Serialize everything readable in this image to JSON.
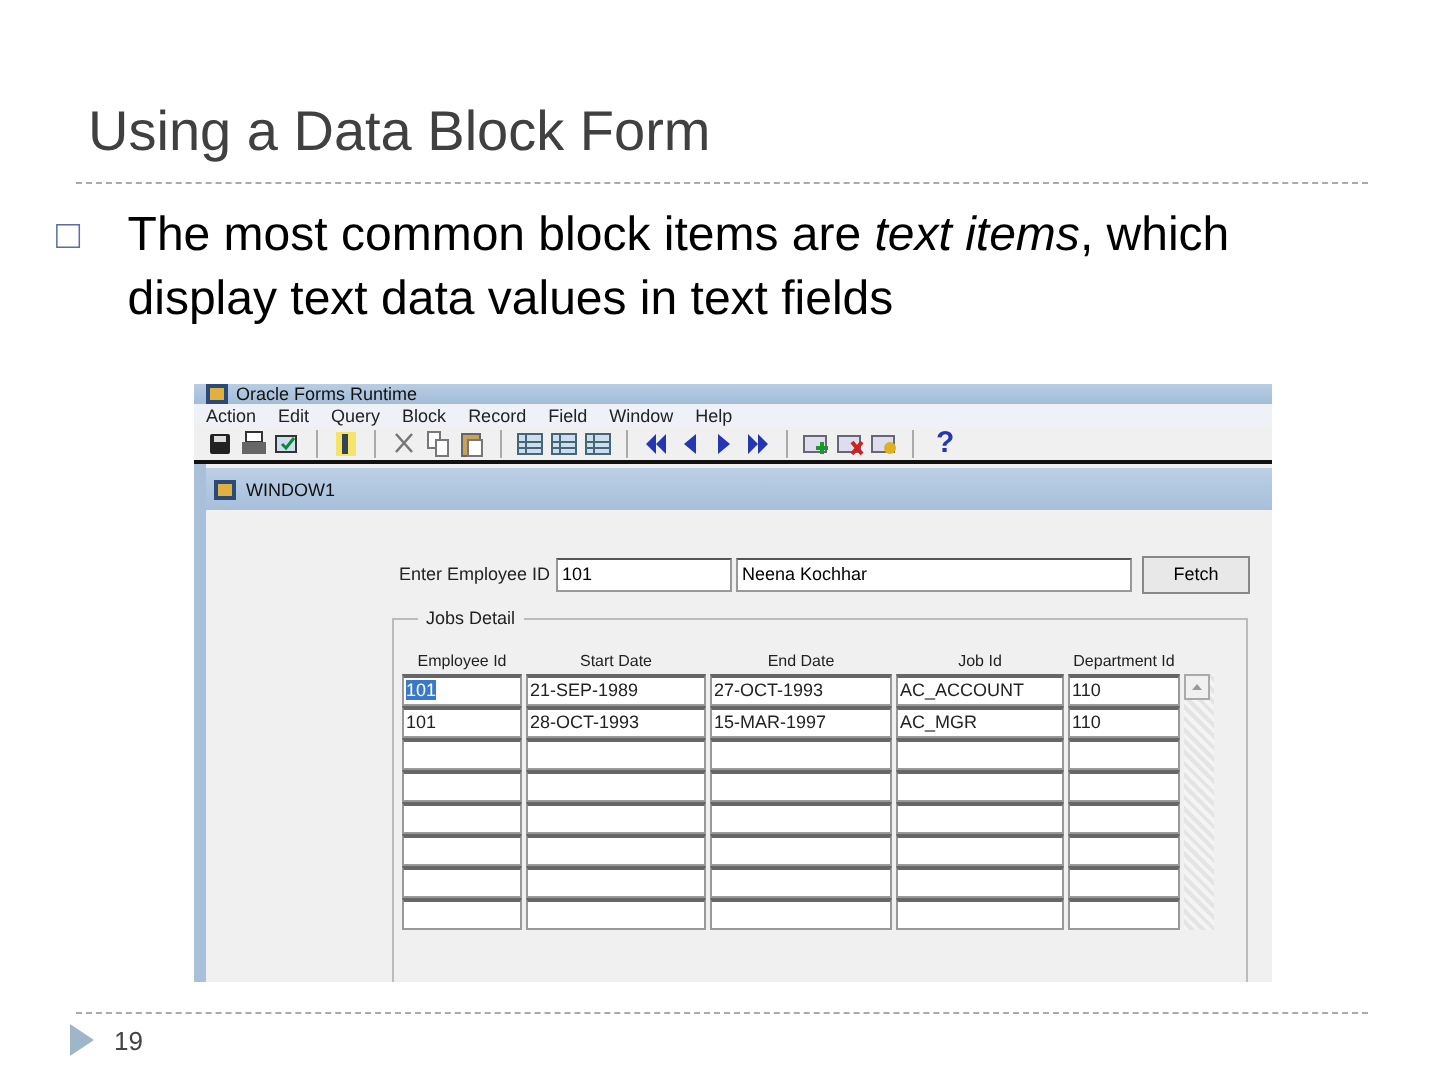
{
  "slide": {
    "title": "Using a Data Block Form",
    "bullet": {
      "marker": "□",
      "text": "The most common block items are *text items*, which display text data values in text fields"
    },
    "page_number": "19"
  },
  "app": {
    "title": "Oracle Forms Runtime",
    "menu": [
      "Action",
      "Edit",
      "Query",
      "Block",
      "Record",
      "Field",
      "Window",
      "Help"
    ],
    "toolbar": [
      {
        "kind": "save"
      },
      {
        "kind": "print"
      },
      {
        "kind": "screen"
      },
      {
        "kind": "sep"
      },
      {
        "kind": "exit"
      },
      {
        "kind": "sep"
      },
      {
        "kind": "cut"
      },
      {
        "kind": "copy"
      },
      {
        "kind": "paste"
      },
      {
        "kind": "sep"
      },
      {
        "kind": "table"
      },
      {
        "kind": "table"
      },
      {
        "kind": "table"
      },
      {
        "kind": "sep"
      },
      {
        "kind": "first"
      },
      {
        "kind": "prev"
      },
      {
        "kind": "next"
      },
      {
        "kind": "last"
      },
      {
        "kind": "sep"
      },
      {
        "kind": "add"
      },
      {
        "kind": "remove"
      },
      {
        "kind": "lock"
      },
      {
        "kind": "sep"
      },
      {
        "kind": "help",
        "text": "?"
      }
    ],
    "window": {
      "title": "WINDOW1",
      "lookup": {
        "label": "Enter Employee ID",
        "id_value": "101",
        "name_value": "Neena Kochhar",
        "button": "Fetch"
      },
      "group": {
        "title": "Jobs Detail",
        "columns": [
          "Employee Id",
          "Start Date",
          "End Date",
          "Job Id",
          "Department Id"
        ],
        "rows": [
          {
            "cells": [
              "101",
              "21-SEP-1989",
              "27-OCT-1993",
              "AC_ACCOUNT",
              "110"
            ],
            "selected": true
          },
          {
            "cells": [
              "101",
              "28-OCT-1993",
              "15-MAR-1997",
              "AC_MGR",
              "110"
            ],
            "selected": false
          }
        ]
      }
    }
  }
}
